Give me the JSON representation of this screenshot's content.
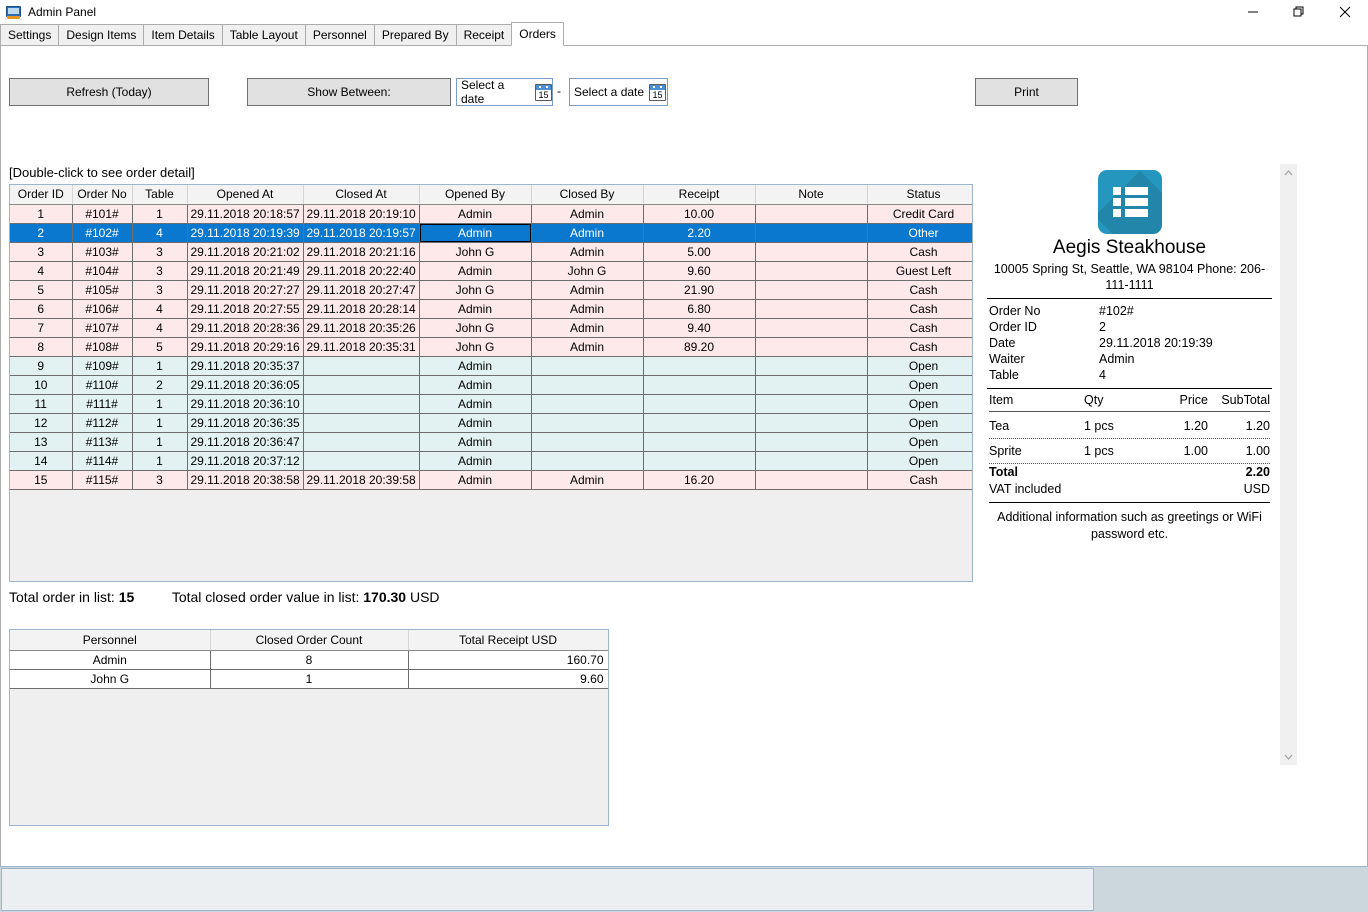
{
  "window": {
    "title": "Admin Panel",
    "icon": "monitor-icon",
    "minimize_label": "minimize-icon",
    "maximize_label": "restore-icon",
    "close_label": "close-icon"
  },
  "tabs": [
    {
      "label": "Settings",
      "active": false
    },
    {
      "label": "Design Items",
      "active": false
    },
    {
      "label": "Item Details",
      "active": false
    },
    {
      "label": "Table Layout",
      "active": false
    },
    {
      "label": "Personnel",
      "active": false
    },
    {
      "label": "Prepared By",
      "active": false
    },
    {
      "label": "Receipt",
      "active": false
    },
    {
      "label": "Orders",
      "active": true
    }
  ],
  "toolbar": {
    "refresh_label": "Refresh (Today)",
    "show_between_label": "Show Between:",
    "print_label": "Print",
    "date_from": "Select a date",
    "date_to": "Select a date",
    "date_separator": "-",
    "calendar_icon_day": "15"
  },
  "orders": {
    "hint": "[Double-click to see order detail]",
    "columns": [
      "Order ID",
      "Order No",
      "Table",
      "Opened At",
      "Closed At",
      "Opened By",
      "Closed By",
      "Receipt",
      "Note",
      "Status"
    ],
    "rows": [
      {
        "id": "1",
        "no": "#101#",
        "table": "1",
        "opened": "29.11.2018 20:18:57",
        "closed": "29.11.2018 20:19:10",
        "opened_by": "Admin",
        "closed_by": "Admin",
        "receipt": "10.00",
        "note": "",
        "status": "Credit Card",
        "state": "closed"
      },
      {
        "id": "2",
        "no": "#102#",
        "table": "4",
        "opened": "29.11.2018 20:19:39",
        "closed": "29.11.2018 20:19:57",
        "opened_by": "Admin",
        "closed_by": "Admin",
        "receipt": "2.20",
        "note": "",
        "status": "Other",
        "state": "selected"
      },
      {
        "id": "3",
        "no": "#103#",
        "table": "3",
        "opened": "29.11.2018 20:21:02",
        "closed": "29.11.2018 20:21:16",
        "opened_by": "John G",
        "closed_by": "Admin",
        "receipt": "5.00",
        "note": "",
        "status": "Cash",
        "state": "closed"
      },
      {
        "id": "4",
        "no": "#104#",
        "table": "3",
        "opened": "29.11.2018 20:21:49",
        "closed": "29.11.2018 20:22:40",
        "opened_by": "Admin",
        "closed_by": "John G",
        "receipt": "9.60",
        "note": "",
        "status": "Guest Left",
        "state": "closed"
      },
      {
        "id": "5",
        "no": "#105#",
        "table": "3",
        "opened": "29.11.2018 20:27:27",
        "closed": "29.11.2018 20:27:47",
        "opened_by": "John G",
        "closed_by": "Admin",
        "receipt": "21.90",
        "note": "",
        "status": "Cash",
        "state": "closed"
      },
      {
        "id": "6",
        "no": "#106#",
        "table": "4",
        "opened": "29.11.2018 20:27:55",
        "closed": "29.11.2018 20:28:14",
        "opened_by": "Admin",
        "closed_by": "Admin",
        "receipt": "6.80",
        "note": "",
        "status": "Cash",
        "state": "closed"
      },
      {
        "id": "7",
        "no": "#107#",
        "table": "4",
        "opened": "29.11.2018 20:28:36",
        "closed": "29.11.2018 20:35:26",
        "opened_by": "John G",
        "closed_by": "Admin",
        "receipt": "9.40",
        "note": "",
        "status": "Cash",
        "state": "closed"
      },
      {
        "id": "8",
        "no": "#108#",
        "table": "5",
        "opened": "29.11.2018 20:29:16",
        "closed": "29.11.2018 20:35:31",
        "opened_by": "John G",
        "closed_by": "Admin",
        "receipt": "89.20",
        "note": "",
        "status": "Cash",
        "state": "closed"
      },
      {
        "id": "9",
        "no": "#109#",
        "table": "1",
        "opened": "29.11.2018 20:35:37",
        "closed": "",
        "opened_by": "Admin",
        "closed_by": "",
        "receipt": "",
        "note": "",
        "status": "Open",
        "state": "open"
      },
      {
        "id": "10",
        "no": "#110#",
        "table": "2",
        "opened": "29.11.2018 20:36:05",
        "closed": "",
        "opened_by": "Admin",
        "closed_by": "",
        "receipt": "",
        "note": "",
        "status": "Open",
        "state": "open"
      },
      {
        "id": "11",
        "no": "#111#",
        "table": "1",
        "opened": "29.11.2018 20:36:10",
        "closed": "",
        "opened_by": "Admin",
        "closed_by": "",
        "receipt": "",
        "note": "",
        "status": "Open",
        "state": "open"
      },
      {
        "id": "12",
        "no": "#112#",
        "table": "1",
        "opened": "29.11.2018 20:36:35",
        "closed": "",
        "opened_by": "Admin",
        "closed_by": "",
        "receipt": "",
        "note": "",
        "status": "Open",
        "state": "open"
      },
      {
        "id": "13",
        "no": "#113#",
        "table": "1",
        "opened": "29.11.2018 20:36:47",
        "closed": "",
        "opened_by": "Admin",
        "closed_by": "",
        "receipt": "",
        "note": "",
        "status": "Open",
        "state": "open"
      },
      {
        "id": "14",
        "no": "#114#",
        "table": "1",
        "opened": "29.11.2018 20:37:12",
        "closed": "",
        "opened_by": "Admin",
        "closed_by": "",
        "receipt": "",
        "note": "",
        "status": "Open",
        "state": "open"
      },
      {
        "id": "15",
        "no": "#115#",
        "table": "3",
        "opened": "29.11.2018 20:38:58",
        "closed": "29.11.2018 20:39:58",
        "opened_by": "Admin",
        "closed_by": "Admin",
        "receipt": "16.20",
        "note": "",
        "status": "Cash",
        "state": "closed"
      }
    ]
  },
  "totals": {
    "orders_label": "Total order in list:",
    "orders_count": "15",
    "value_label": "Total closed order value in list:",
    "value_amount": "170.30",
    "value_currency": "USD"
  },
  "personnel": {
    "columns": [
      "Personnel",
      "Closed Order Count",
      "Total Receipt USD"
    ],
    "rows": [
      {
        "name": "Admin",
        "closed_order_count": "8",
        "total_receipt": "160.70"
      },
      {
        "name": "John G",
        "closed_order_count": "1",
        "total_receipt": "9.60"
      }
    ]
  },
  "receipt": {
    "logo_icon": "list-logo-icon",
    "shop_name": "Aegis Steakhouse",
    "shop_address": "10005 Spring St, Seattle, WA 98104 Phone: 206-111-1111",
    "meta": [
      {
        "key": "Order No",
        "value": "#102#"
      },
      {
        "key": "Order ID",
        "value": "2"
      },
      {
        "key": "Date",
        "value": "29.11.2018 20:19:39"
      },
      {
        "key": "Waiter",
        "value": "Admin"
      },
      {
        "key": "Table",
        "value": "4"
      }
    ],
    "item_columns": [
      "Item",
      "Qty",
      "Price",
      "SubTotal"
    ],
    "items": [
      {
        "name": "Tea",
        "qty": "1 pcs",
        "price": "1.20",
        "subtotal": "1.20"
      },
      {
        "name": "Sprite",
        "qty": "1 pcs",
        "price": "1.00",
        "subtotal": "1.00"
      }
    ],
    "total_label": "Total",
    "total_value": "2.20",
    "vat_label": "VAT included",
    "currency": "USD",
    "footer_note": "Additional information such as greetings or WiFi password etc."
  },
  "colors": {
    "accent": "#0b78d0",
    "logo": "#2596be",
    "row_closed": "#fde9e9",
    "row_open": "#e2f1f1",
    "status_bar": "#ccd6dd"
  }
}
